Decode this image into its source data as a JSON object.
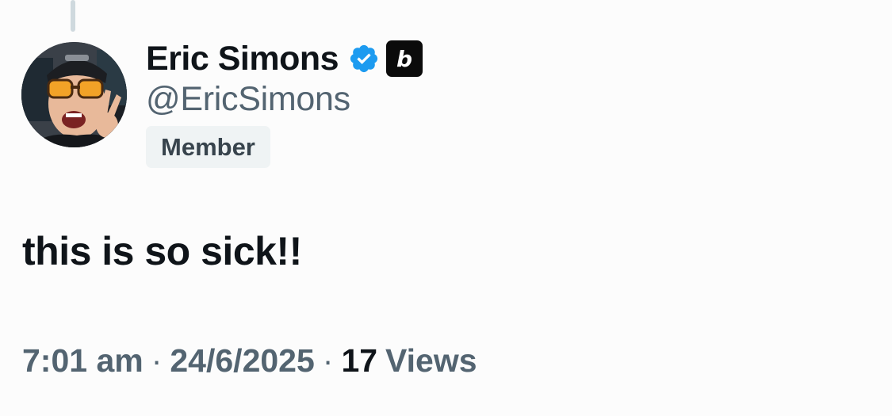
{
  "author": {
    "display_name": "Eric Simons",
    "handle": "@EricSimons",
    "verified_icon": "verified-badge-icon",
    "affiliate_badge": "b",
    "member_label": "Member",
    "avatar_icon": "user-avatar"
  },
  "tweet": {
    "text": "this is so sick!!",
    "time": "7:01 am",
    "date": "24/6/2025",
    "separator": "·",
    "views_count": "17",
    "views_label": "Views"
  },
  "colors": {
    "verified_blue": "#1d9bf0",
    "text_primary": "#0f1419",
    "text_secondary": "#536471",
    "badge_bg": "#eff3f4"
  }
}
